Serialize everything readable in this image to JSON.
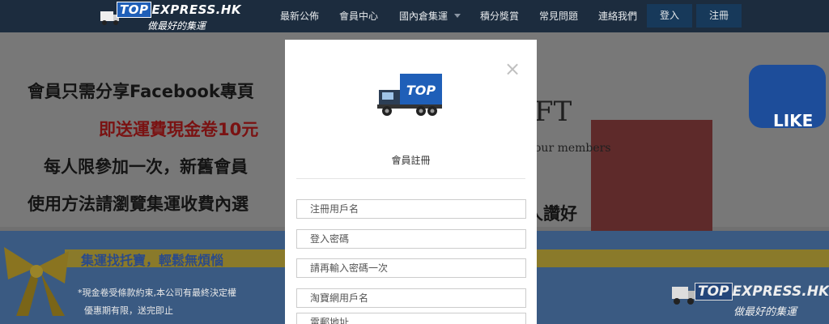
{
  "nav": {
    "logo": {
      "top": "TOP",
      "suffix": "EXPRESS.HK",
      "tagline": "做最好的集運"
    },
    "items": [
      "最新公佈",
      "會員中心",
      "國內倉集運",
      "積分獎賞",
      "常見問題",
      "連絡我們"
    ],
    "login_label": "登入",
    "register_label": "注冊"
  },
  "banner": {
    "line1": "會員只需分享Facebook專頁",
    "line2": "即送運費現金卷10元",
    "line3": "每人限參加一次，新舊會員",
    "line4": "使用方法請瀏覽集運收費內選",
    "gift_text": "FT",
    "gift_subtext": "our members",
    "like_text": "LIKE",
    "right_line": "人讚好",
    "strip_text": "集運找托寶，輕鬆無煩惱",
    "note1": "*現金卷受條款約束,本公司有最終決定權",
    "note2": "優惠期有限，送完即止",
    "logo": {
      "top": "TOP",
      "suffix": "EXPRESS.HK",
      "tagline": "做最好的集運"
    }
  },
  "modal": {
    "logo_text": "TOP",
    "title": "會員註冊",
    "fields": {
      "username": "注冊用戶名",
      "password": "登入密碼",
      "confirm_password": "請再輸入密碼一次",
      "taobao_username": "淘寶網用戶名",
      "email": "電郵地址"
    }
  },
  "colors": {
    "nav_bg": "#1c2c3e",
    "accent_blue": "#1f5fb8",
    "overlay": "#6b6b6b"
  }
}
